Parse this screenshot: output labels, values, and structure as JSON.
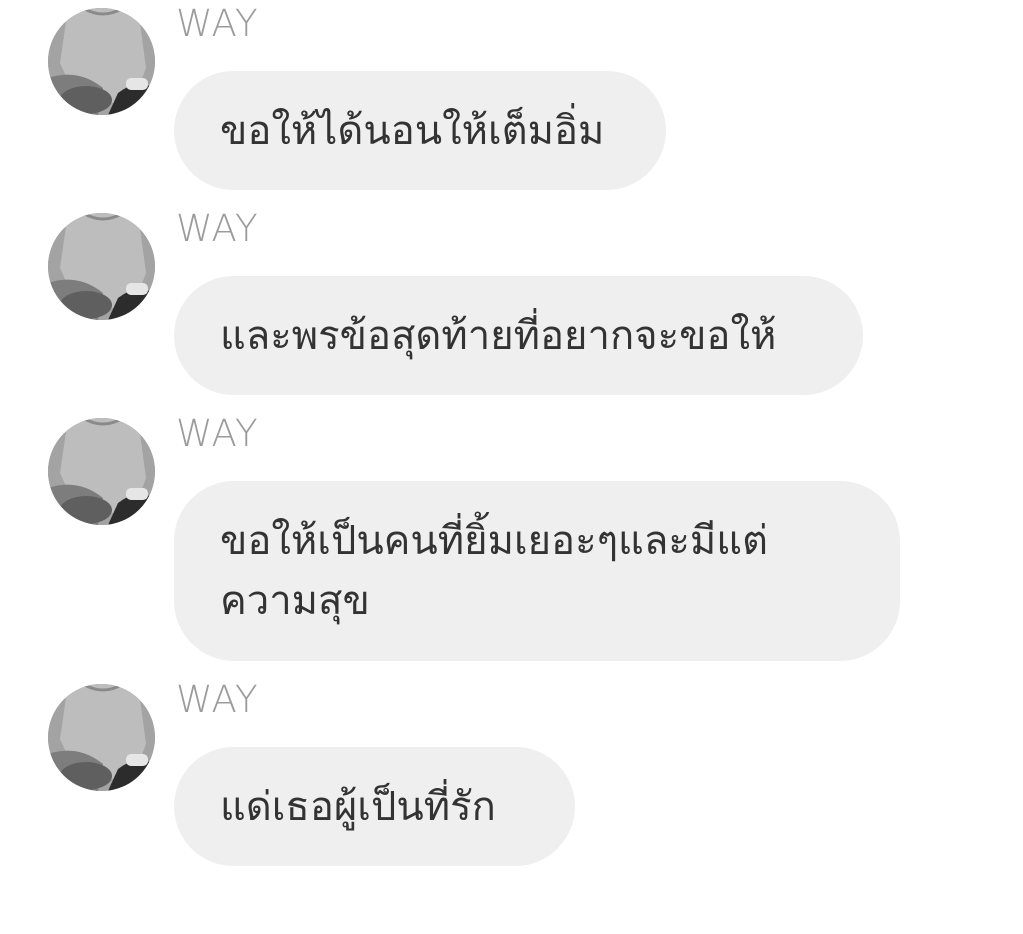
{
  "chat": {
    "messages": [
      {
        "sender": "WAY",
        "text": "ขอให้ได้นอนให้เต็มอิ่ม",
        "avatar_icon": "user-photo-avatar"
      },
      {
        "sender": "WAY",
        "text": "และพรข้อสุดท้ายที่อยากจะขอให้",
        "avatar_icon": "user-photo-avatar"
      },
      {
        "sender": "WAY",
        "text": "ขอให้เป็นคนที่ยิ้มเยอะๆและมีแต่ความสุข",
        "avatar_icon": "user-photo-avatar"
      },
      {
        "sender": "WAY",
        "text": "แด่เธอผู้เป็นที่รัก",
        "avatar_icon": "user-photo-avatar"
      }
    ]
  },
  "colors": {
    "bubble_bg": "#efefef",
    "bubble_text": "#333333",
    "sender_text": "#9b9b9b",
    "background": "#ffffff"
  }
}
